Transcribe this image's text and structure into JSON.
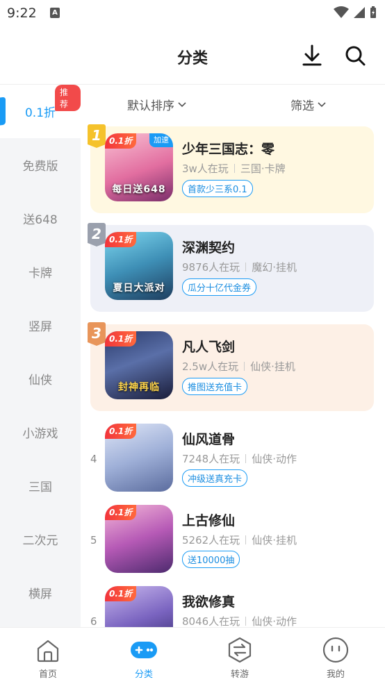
{
  "status": {
    "time": "9:22"
  },
  "header": {
    "title": "分类"
  },
  "sidebar": {
    "items": [
      {
        "label": "0.1折",
        "badge": "推荐"
      },
      {
        "label": "免费版"
      },
      {
        "label": "送648"
      },
      {
        "label": "卡牌"
      },
      {
        "label": "竖屏"
      },
      {
        "label": "仙侠"
      },
      {
        "label": "小游戏"
      },
      {
        "label": "三国"
      },
      {
        "label": "二次元"
      },
      {
        "label": "横屏"
      }
    ]
  },
  "filters": {
    "sort": "默认排序",
    "filter": "筛选"
  },
  "games": [
    {
      "rank": "1",
      "name": "少年三国志：零",
      "players": "3w人在玩",
      "genre": "三国·卡牌",
      "promo": "首款少三系0.1",
      "discount": "0.1折",
      "extra_tag": "加速",
      "art_text": "每日送648"
    },
    {
      "rank": "2",
      "name": "深渊契约",
      "players": "9876人在玩",
      "genre": "魔幻·挂机",
      "promo": "瓜分十亿代金券",
      "discount": "0.1折",
      "art_text": "夏日大派对"
    },
    {
      "rank": "3",
      "name": "凡人飞剑",
      "players": "2.5w人在玩",
      "genre": "仙侠·挂机",
      "promo": "推图送充值卡",
      "discount": "0.1折",
      "art_text": "封神再临"
    },
    {
      "rank": "4",
      "name": "仙风道骨",
      "players": "7248人在玩",
      "genre": "仙侠·动作",
      "promo": "冲级送真充卡",
      "discount": "0.1折"
    },
    {
      "rank": "5",
      "name": "上古修仙",
      "players": "5262人在玩",
      "genre": "仙侠·挂机",
      "promo": "送10000抽",
      "discount": "0.1折"
    },
    {
      "rank": "6",
      "name": "我欲修真",
      "players": "8046人在玩",
      "genre": "仙侠·动作",
      "discount": "0.1折"
    }
  ],
  "tabs": [
    {
      "label": "首页"
    },
    {
      "label": "分类"
    },
    {
      "label": "转游"
    },
    {
      "label": "我的"
    }
  ],
  "colors": {
    "accent": "#1a9bf5",
    "badge": "#f24a4a",
    "gold": "#f5c22b",
    "silver": "#9aa0ad",
    "bronze": "#e8955a"
  }
}
